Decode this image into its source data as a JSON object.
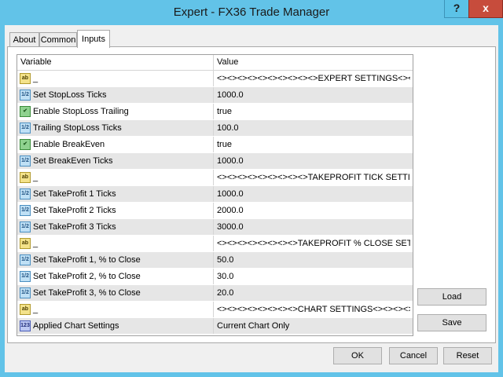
{
  "window": {
    "title": "Expert - FX36 Trade Manager",
    "help_label": "?",
    "close_label": "x"
  },
  "tabs": [
    {
      "label": "About"
    },
    {
      "label": "Common"
    },
    {
      "label": "Inputs"
    }
  ],
  "grid": {
    "col_variable": "Variable",
    "col_value": "Value",
    "rows": [
      {
        "icon": "ab",
        "name": "_",
        "value": "<><><><><><><><><><>EXPERT SETTINGS<><><><><..."
      },
      {
        "icon": "num",
        "name": "Set StopLoss Ticks",
        "value": "1000.0"
      },
      {
        "icon": "bool",
        "name": "Enable StopLoss Trailing",
        "value": "true"
      },
      {
        "icon": "num",
        "name": "Trailing StopLoss Ticks",
        "value": "100.0"
      },
      {
        "icon": "bool",
        "name": "Enable BreakEven",
        "value": "true"
      },
      {
        "icon": "num",
        "name": "Set BreakEven Ticks",
        "value": "1000.0"
      },
      {
        "icon": "ab",
        "name": "_",
        "value": "<><><><><><><><><>TAKEPROFIT TICK SETTINGS<>..."
      },
      {
        "icon": "num",
        "name": "Set TakeProfit 1 Ticks",
        "value": "1000.0"
      },
      {
        "icon": "num",
        "name": "Set TakeProfit 2 Ticks",
        "value": "2000.0"
      },
      {
        "icon": "num",
        "name": "Set TakeProfit 3 Ticks",
        "value": "3000.0"
      },
      {
        "icon": "ab",
        "name": "_",
        "value": "<><><><><><><><>TAKEPROFIT % CLOSE SETTINGS<..."
      },
      {
        "icon": "num",
        "name": "Set TakeProfit 1, % to Close",
        "value": "50.0"
      },
      {
        "icon": "num",
        "name": "Set TakeProfit 2, % to Close",
        "value": "30.0"
      },
      {
        "icon": "num",
        "name": "Set TakeProfit 3, % to Close",
        "value": "20.0"
      },
      {
        "icon": "ab",
        "name": "_",
        "value": "<><><><><><><><>CHART SETTINGS<><><><><><>..."
      },
      {
        "icon": "set",
        "name": "Applied Chart Settings",
        "value": "Current Chart Only"
      }
    ]
  },
  "icons": {
    "ab": "ab",
    "num": "1/2",
    "bool": "✔",
    "set": "123"
  },
  "buttons": {
    "load": "Load",
    "save": "Save",
    "ok": "OK",
    "cancel": "Cancel",
    "reset": "Reset"
  }
}
